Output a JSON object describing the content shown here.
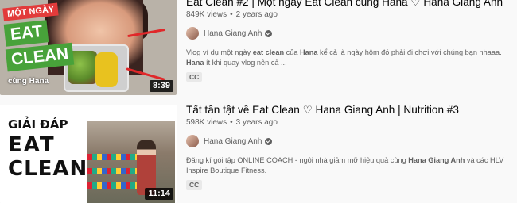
{
  "results": [
    {
      "title": "Eat Clean #2 | Một ngày Eat Clean cùng Hana ♡ Hana Giang Anh",
      "views": "849K views",
      "age": "2 years ago",
      "channel": "Hana Giang Anh",
      "description_parts": [
        "Vlog ví dụ một ngày ",
        "eat clean",
        " của ",
        "Hana",
        " kể cả là ngày hôm đó phải đi chơi với chúng bạn nhaaa. ",
        "Hana",
        " ít khi quay vlog nên cả ..."
      ],
      "badge": "CC",
      "duration": "8:39",
      "thumb": {
        "top_banner": "MỘT NGÀY",
        "word1": "EAT",
        "word2": "CLEAN",
        "caption": "cùng Hana"
      }
    },
    {
      "title": "Tất tần tật về Eat Clean ♡ Hana Giang Anh | Nutrition #3",
      "views": "598K views",
      "age": "3 years ago",
      "channel": "Hana Giang Anh",
      "description_parts": [
        "Đăng kí gói tập ONLINE COACH - ngôi nhà giảm mỡ hiệu quả cùng ",
        "Hana Giang Anh",
        " và các HLV Inspire Boutique Fitness."
      ],
      "badge": "CC",
      "duration": "11:14",
      "thumb": {
        "line1": "GIẢI ĐÁP",
        "line2": "EAT",
        "line3": "CLEAN"
      }
    }
  ]
}
